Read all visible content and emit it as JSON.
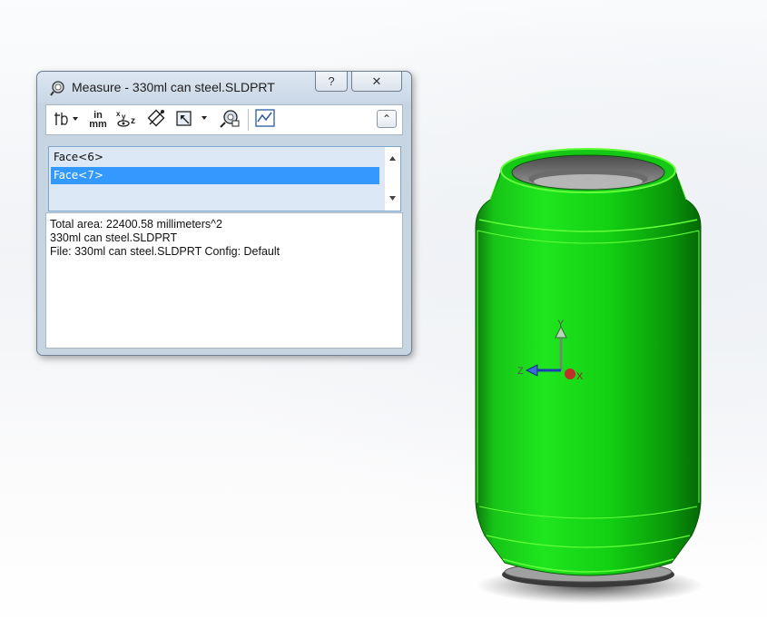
{
  "dialog": {
    "title": "Measure - 330ml can steel.SLDPRT",
    "help_label": "?",
    "close_label": "✕",
    "toolbar": {
      "items": [
        {
          "name": "arc-circle-measure-icon"
        },
        {
          "name": "units-precision-icon",
          "label_top": "in",
          "label_bottom": "mm"
        },
        {
          "name": "show-xyz-measurements-icon"
        },
        {
          "name": "point-to-point-icon"
        },
        {
          "name": "projection-icon"
        },
        {
          "name": "coordinate-system-icon"
        },
        {
          "name": "measurement-history-icon"
        }
      ],
      "collapse_label": "⌃"
    },
    "selections": [
      {
        "label": "Face<6>",
        "selected": false
      },
      {
        "label": "Face<7>",
        "selected": true
      }
    ],
    "results": [
      "Total area: 22400.58 millimeters^2",
      "330ml can steel.SLDPRT",
      "File: 330ml can steel.SLDPRT Config: Default"
    ]
  },
  "viewport": {
    "triad": {
      "x_label": "X",
      "y_label": "Y",
      "z_label": "Z"
    },
    "model_color": "#16e016",
    "edge_color": "#62ff3a"
  }
}
